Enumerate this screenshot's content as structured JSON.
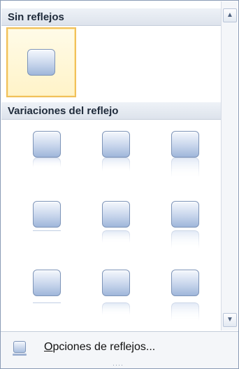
{
  "gallery": {
    "sections": [
      {
        "title": "Sin reflejos"
      },
      {
        "title": "Variaciones del reflejo"
      }
    ],
    "selected_item": "sin-reflejo"
  },
  "footer": {
    "options_label": "Opciones de reflejos...",
    "grip_glyph": "····"
  },
  "scrollbar": {
    "up_glyph": "▲",
    "down_glyph": "▼"
  },
  "icons": {
    "options": "reflection-options-icon",
    "grip": "resize-grip-icon"
  },
  "colors": {
    "selection_border": "#f1c05a",
    "selection_fill": "#fff3c8",
    "thumb_border": "#7d94b8",
    "header_bg": "#dde3ec"
  }
}
